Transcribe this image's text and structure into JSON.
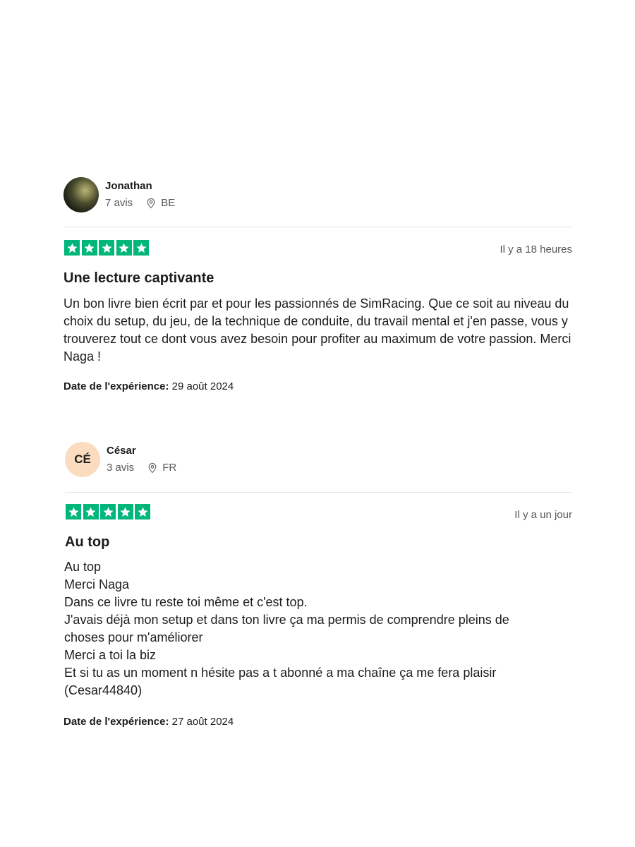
{
  "star_color": "#00b67a",
  "reviews": [
    {
      "author": {
        "name": "Jonathan",
        "reviews_count": "7 avis",
        "country": "BE",
        "avatar": "photo"
      },
      "rating": 5,
      "relative_date": "Il y a 18 heures",
      "title": "Une lecture captivante",
      "body": "Un bon livre bien écrit par et pour les passionnés de SimRacing. Que ce soit au niveau du choix du setup, du jeu, de la technique de conduite, du travail mental et j'en passe, vous y trouverez tout ce dont vous avez besoin pour profiter au maximum de votre passion. Merci Naga !",
      "experience_label": "Date de l'expérience:",
      "experience_date": "29 août 2024"
    },
    {
      "author": {
        "name": "César",
        "reviews_count": "3 avis",
        "country": "FR",
        "avatar_initials": "CÉ"
      },
      "rating": 5,
      "relative_date": "Il y a un jour",
      "title": "Au top",
      "body": "Au top\nMerci Naga\nDans ce livre tu reste toi même et c'est top.\nJ'avais déjà mon setup et dans ton livre ça ma permis de comprendre pleins de choses pour m'améliorer\nMerci a toi la biz\nEt si tu as un moment n hésite pas a t abonné a ma chaîne ça me fera plaisir (Cesar44840)",
      "experience_label": "Date de l'expérience:",
      "experience_date": "27 août 2024"
    }
  ]
}
